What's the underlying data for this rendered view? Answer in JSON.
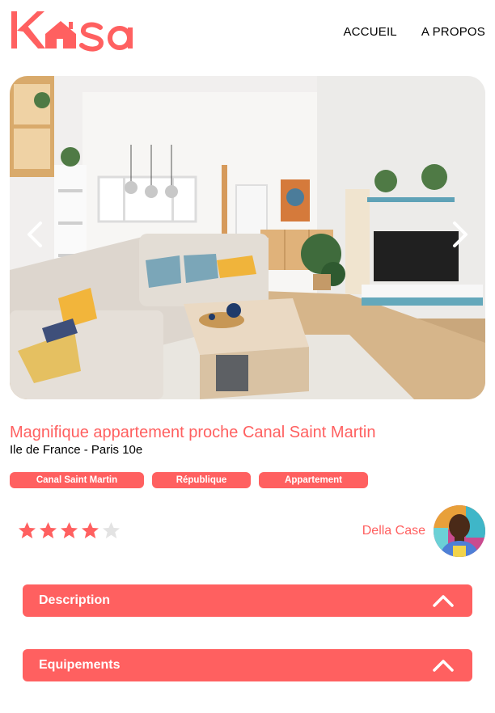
{
  "brand": {
    "logo_text": "Kasa",
    "accent": "#FF6060"
  },
  "nav": {
    "items": [
      {
        "label": "ACCUEIL"
      },
      {
        "label": "A PROPOS"
      }
    ]
  },
  "gallery": {
    "prev_icon": "chevron-left-icon",
    "next_icon": "chevron-right-icon"
  },
  "listing": {
    "title": "Magnifique appartement proche Canal Saint Martin",
    "location": "Ile de France - Paris 10e",
    "tags": [
      "Canal Saint Martin",
      "République",
      "Appartement"
    ],
    "rating": 4,
    "rating_max": 5,
    "host": {
      "name": "Della Case"
    }
  },
  "sections": [
    {
      "label": "Description",
      "icon": "chevron-up-icon"
    },
    {
      "label": "Equipements",
      "icon": "chevron-up-icon"
    }
  ]
}
